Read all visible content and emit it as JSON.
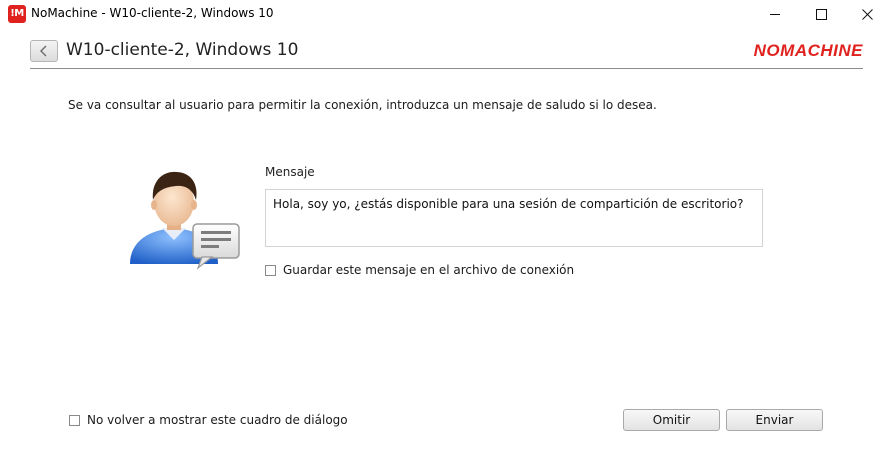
{
  "window": {
    "title": "NoMachine - W10-cliente-2, Windows 10",
    "app_icon_text": "!M"
  },
  "header": {
    "title": "W10-cliente-2, Windows 10",
    "logo_text": "NOMACHINE"
  },
  "instruction": "Se va consultar al usuario para permitir la conexión, introduzca un mensaje de saludo si lo desea.",
  "message": {
    "label": "Mensaje",
    "value": "Hola, soy yo, ¿estás disponible para una sesión de compartición de escritorio?"
  },
  "save_checkbox": {
    "label": "Guardar este mensaje en el archivo de conexión",
    "checked": false
  },
  "dont_show_checkbox": {
    "label": "No volver a mostrar este cuadro de diálogo",
    "checked": false
  },
  "buttons": {
    "omit": "Omitir",
    "send": "Enviar"
  },
  "colors": {
    "brand": "#e0221f",
    "avatar_shirt": "#3a78d8"
  },
  "icons": {
    "app": "nomachine-app-icon",
    "back": "chevron-left-icon",
    "avatar": "user-with-message-icon"
  }
}
